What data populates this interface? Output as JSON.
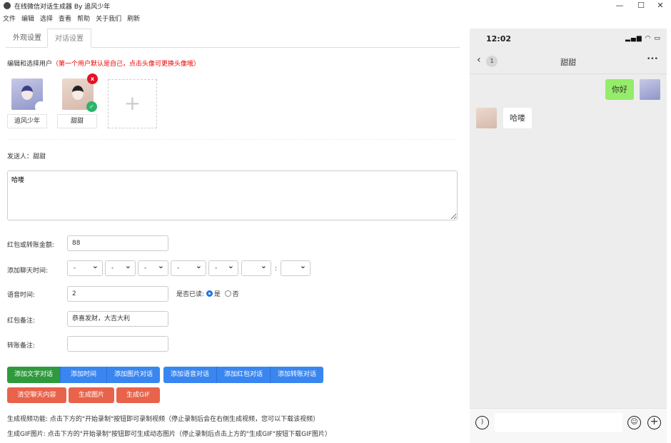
{
  "window": {
    "title": "在线微信对话生成器 By 追风少年",
    "minimize": "—",
    "maximize": "☐",
    "close": "✕"
  },
  "menu": [
    "文件",
    "编辑",
    "选择",
    "查看",
    "帮助",
    "关于我们",
    "刷新"
  ],
  "tabs": [
    {
      "label": "外观设置"
    },
    {
      "label": "对话设置"
    }
  ],
  "users": {
    "heading": "编辑和选择用户",
    "note": "（第一个用户默认是自己，点击头像可更换头像哦）",
    "list": [
      {
        "name": "追风少年"
      },
      {
        "name": "甜甜"
      }
    ],
    "delete_badge": "x",
    "add": "+"
  },
  "sender": {
    "label": "发送人：",
    "value": "甜甜"
  },
  "message": {
    "value": "哈喽"
  },
  "form": {
    "amount": {
      "label": "红包或转账金额:",
      "value": "88"
    },
    "time": {
      "label": "添加聊天时间:",
      "selects": [
        "-",
        "-",
        "-",
        "-",
        "-",
        "",
        ""
      ],
      "colon": ":"
    },
    "voice": {
      "label": "语音时间:",
      "value": "2",
      "read_label": "是否已读:",
      "yes": "是",
      "no": "否",
      "selected": "是"
    },
    "redpacket_note": {
      "label": "红包备注:",
      "value": "恭喜发财，大吉大利"
    },
    "transfer_note": {
      "label": "转账备注:",
      "value": ""
    }
  },
  "buttons": {
    "group1": [
      "添加文字对话",
      "添加时间",
      "添加图片对话"
    ],
    "group2": [
      "添加语音对话",
      "添加红包对话",
      "添加转账对话"
    ],
    "clear": "清空聊天内容",
    "gen_image": "生成图片",
    "gen_gif": "生成GIF"
  },
  "hints": [
    "生成视频功能: 点击下方的\"开始录制\"按钮即可录制视频（停止录制后会在右侧生成视频，您可以下载该视频）",
    "生成GIF图片: 点击下方的\"开始录制\"按钮即可生成动态图片（停止录制后点击上方的\"生成GIF\"按钮下载GIF图片）"
  ],
  "phone": {
    "time": "12:02",
    "unread": "1",
    "contact": "甜甜",
    "more": "•••",
    "messages": [
      {
        "from": "self",
        "text": "你好"
      },
      {
        "from": "other",
        "text": "哈喽"
      }
    ]
  }
}
